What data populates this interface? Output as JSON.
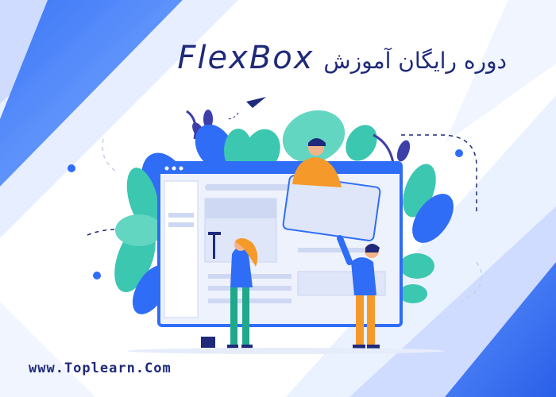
{
  "banner": {
    "title_latin": "FlexBox",
    "title_persian": "دوره رایگان آموزش",
    "website": "www.Toplearn.Com"
  },
  "colors": {
    "navy": "#1f2a7a",
    "blue": "#2f6df6",
    "light_blue": "#dbe6ff",
    "teal": "#3cc7b0",
    "orange": "#f59a2a"
  },
  "icons": [
    "paper-plane-icon"
  ]
}
